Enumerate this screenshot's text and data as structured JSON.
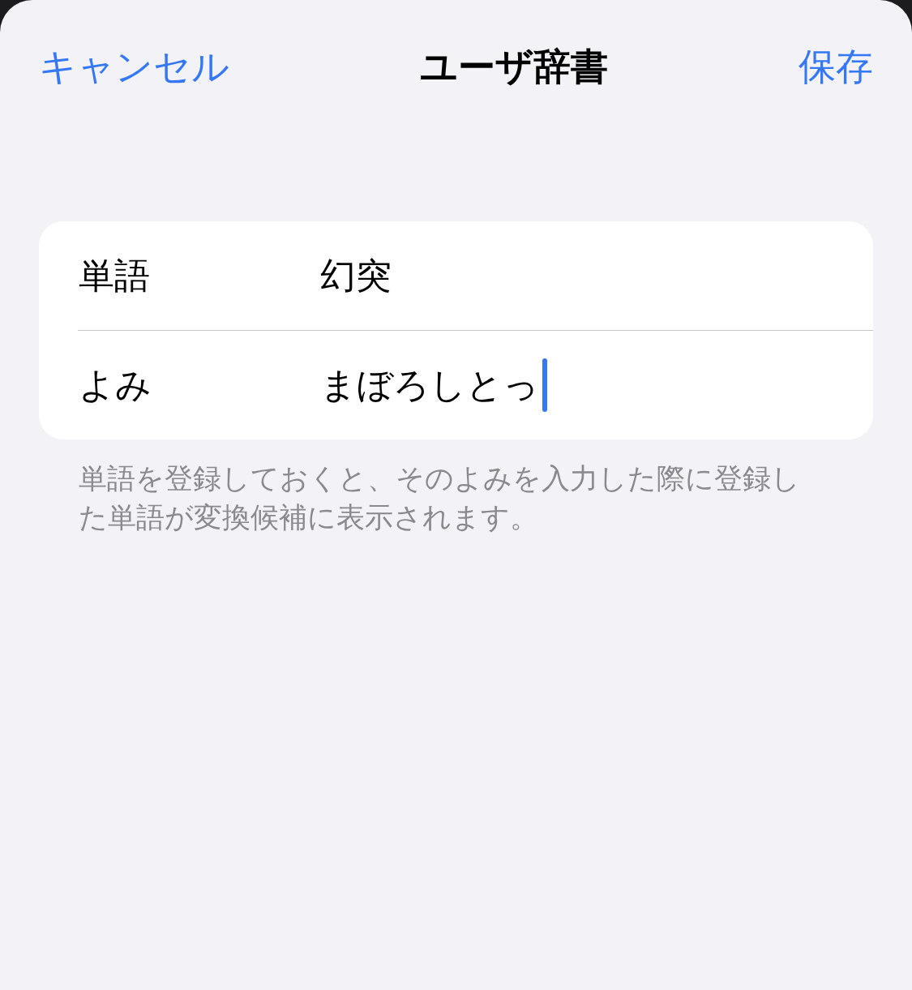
{
  "nav_bar": {
    "cancel": "キャンセル",
    "title": "ユーザ辞書",
    "save": "保存"
  },
  "form": {
    "rows": [
      {
        "label": "単語",
        "value": "幻突",
        "focused": false
      },
      {
        "label": "よみ",
        "value": "まぼろしとっ",
        "focused": true
      }
    ]
  },
  "footer": "単語を登録しておくと、そのよみを入力した際に登録した単語が変換候補に表示されます。"
}
